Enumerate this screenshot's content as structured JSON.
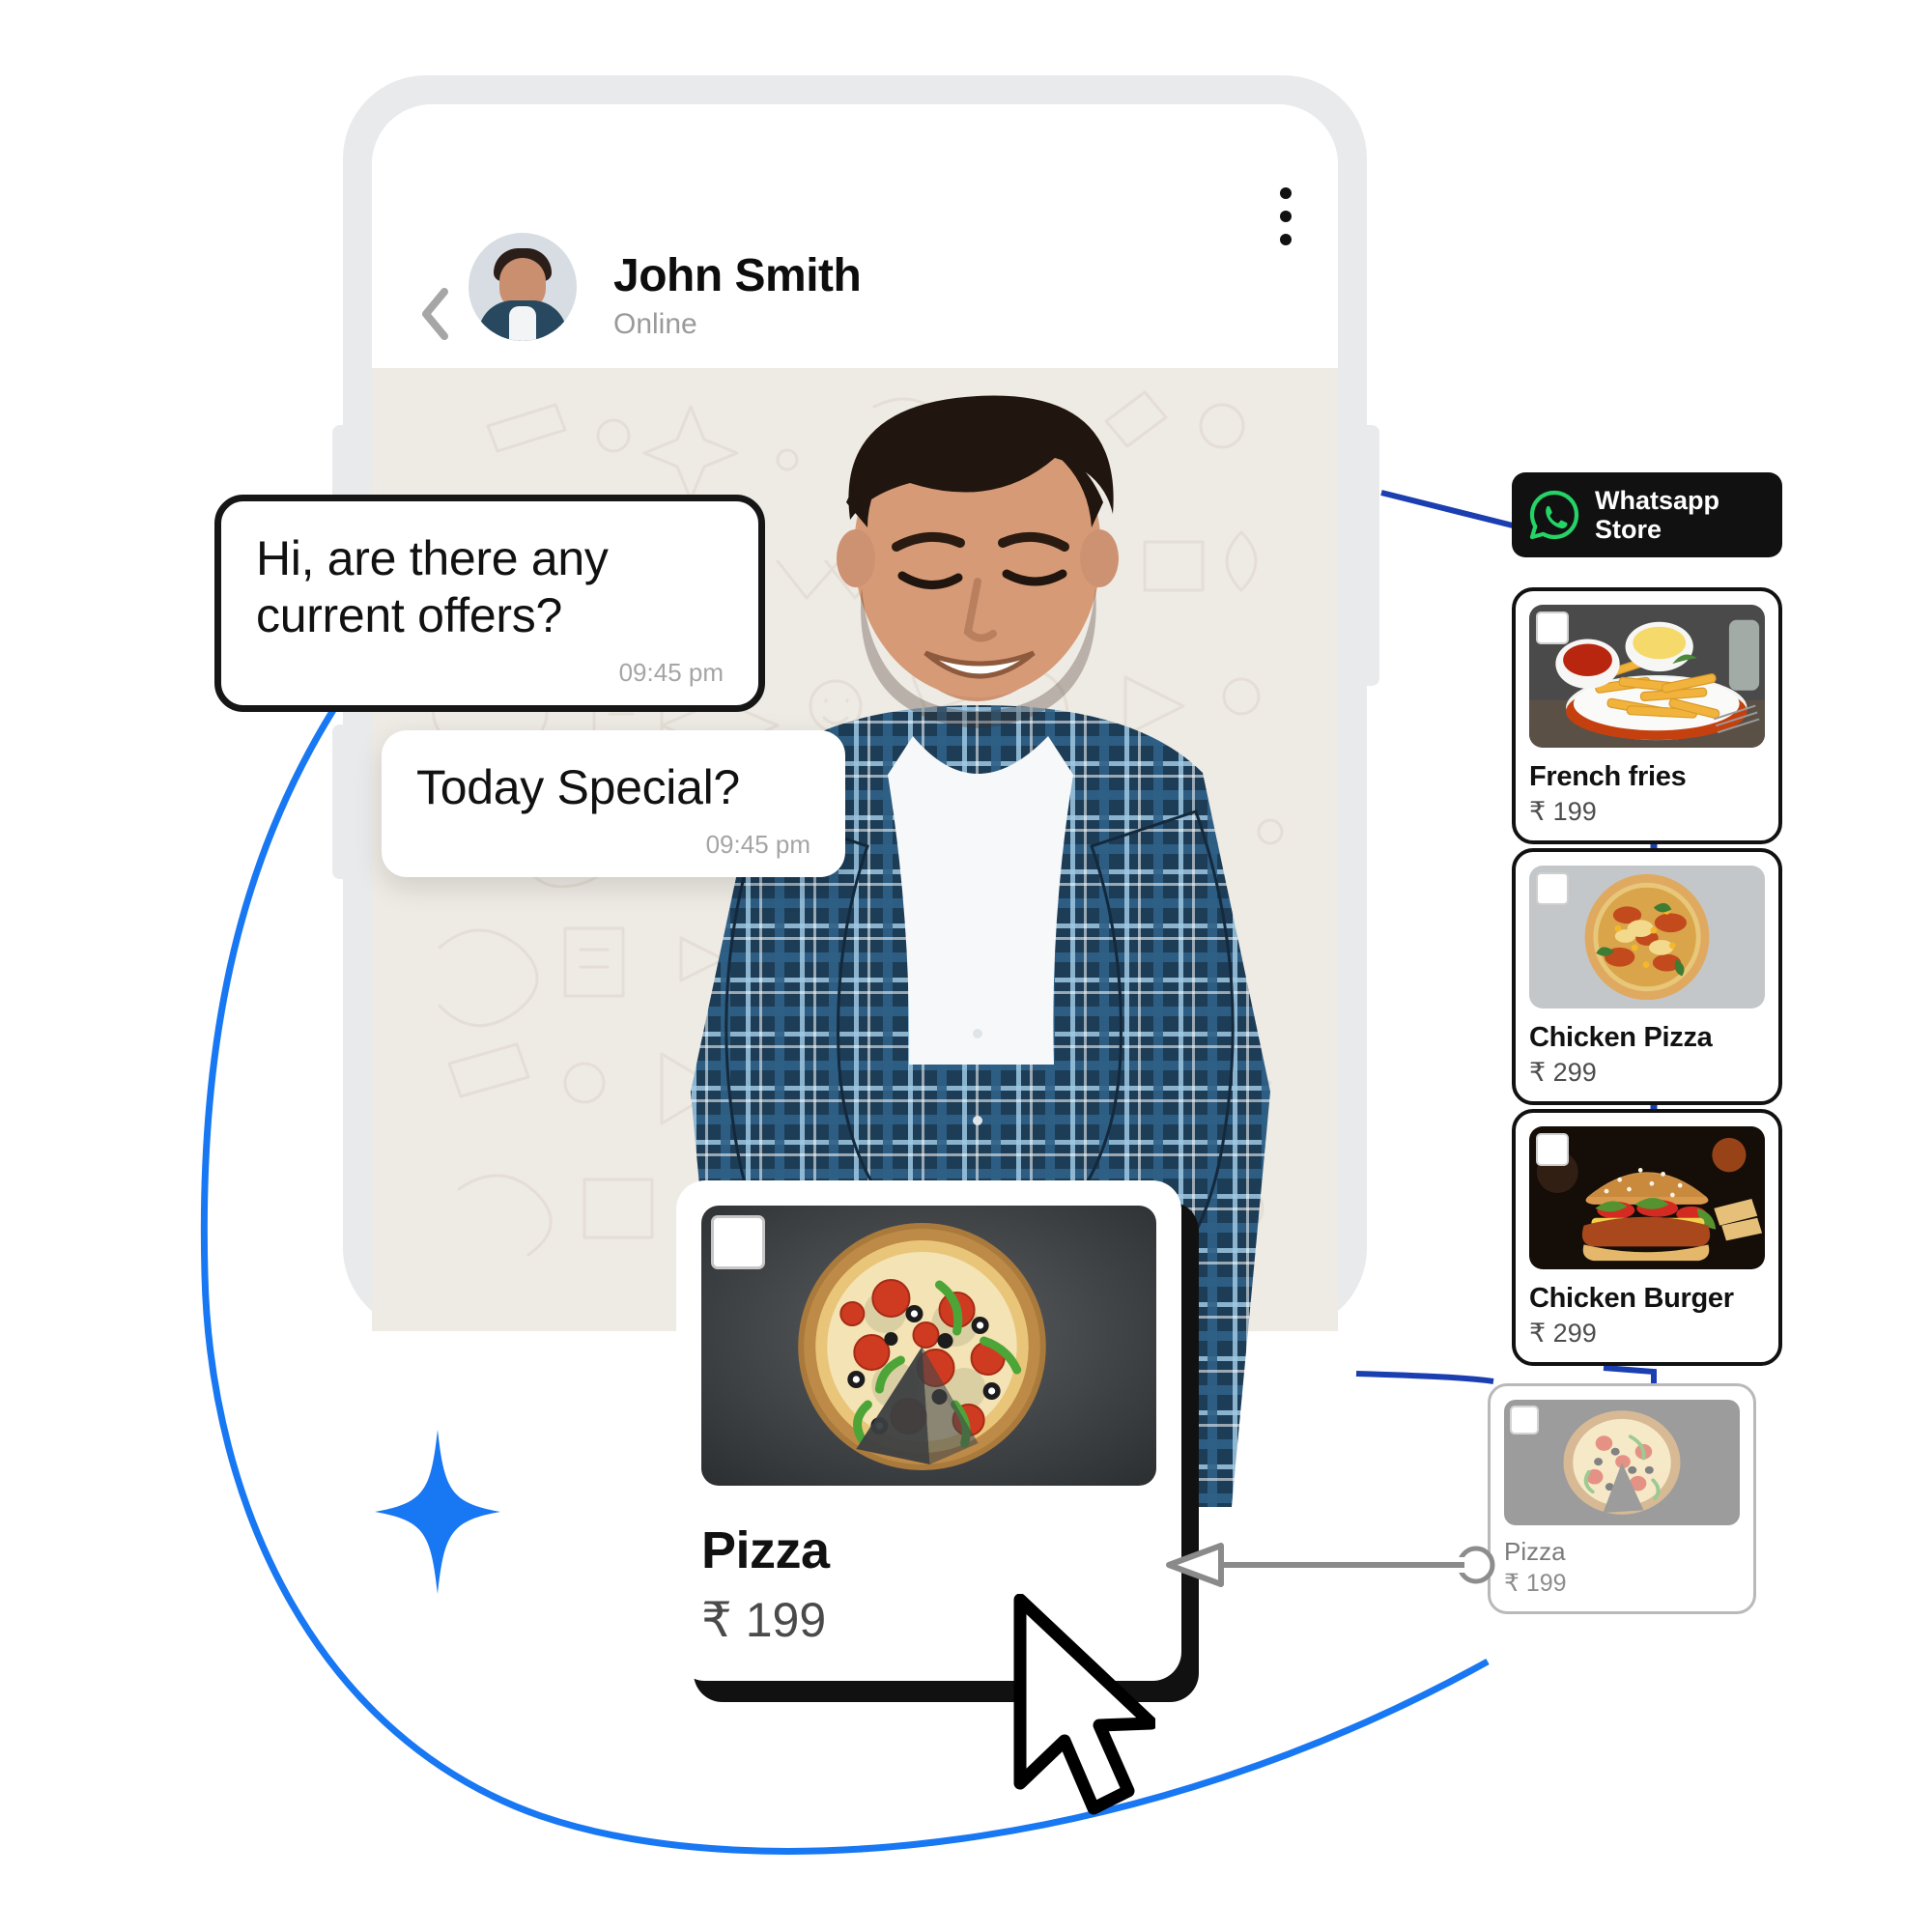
{
  "phone": {
    "header": {
      "back_icon": "chevron-left-icon",
      "avatar_alt": "John Smith avatar",
      "name": "John Smith",
      "status": "Online",
      "menu_icon": "kebab-menu-icon"
    },
    "messages": [
      {
        "text": "Hi, are there any current offers?",
        "time": "09:45 pm"
      },
      {
        "text": "Today Special?",
        "time": "09:45 pm"
      }
    ]
  },
  "store": {
    "badge": {
      "icon": "whatsapp-icon",
      "line1": "Whatsapp",
      "line2": "Store",
      "bg_color": "#111111",
      "icon_color": "#25D366"
    },
    "products": [
      {
        "name": "French fries",
        "price": "₹ 199",
        "image": "french-fries-photo",
        "selected": false
      },
      {
        "name": "Chicken Pizza",
        "price": "₹ 299",
        "image": "chicken-pizza-photo",
        "selected": false
      },
      {
        "name": "Chicken Burger",
        "price": "₹ 299",
        "image": "chicken-burger-photo",
        "selected": false
      },
      {
        "name": "Pizza",
        "price": "₹ 199",
        "image": "pepperoni-pizza-photo",
        "selected": false
      }
    ]
  },
  "highlight_card": {
    "name": "Pizza",
    "price": "₹ 199",
    "image": "pepperoni-pizza-photo",
    "checkbox": "product-checkbox"
  },
  "decor": {
    "accent_color": "#1877F2",
    "sparkle_icon": "four-point-star-icon",
    "cursor_icon": "mouse-pointer-icon",
    "connector_arrow_icon": "left-arrow-icon"
  }
}
